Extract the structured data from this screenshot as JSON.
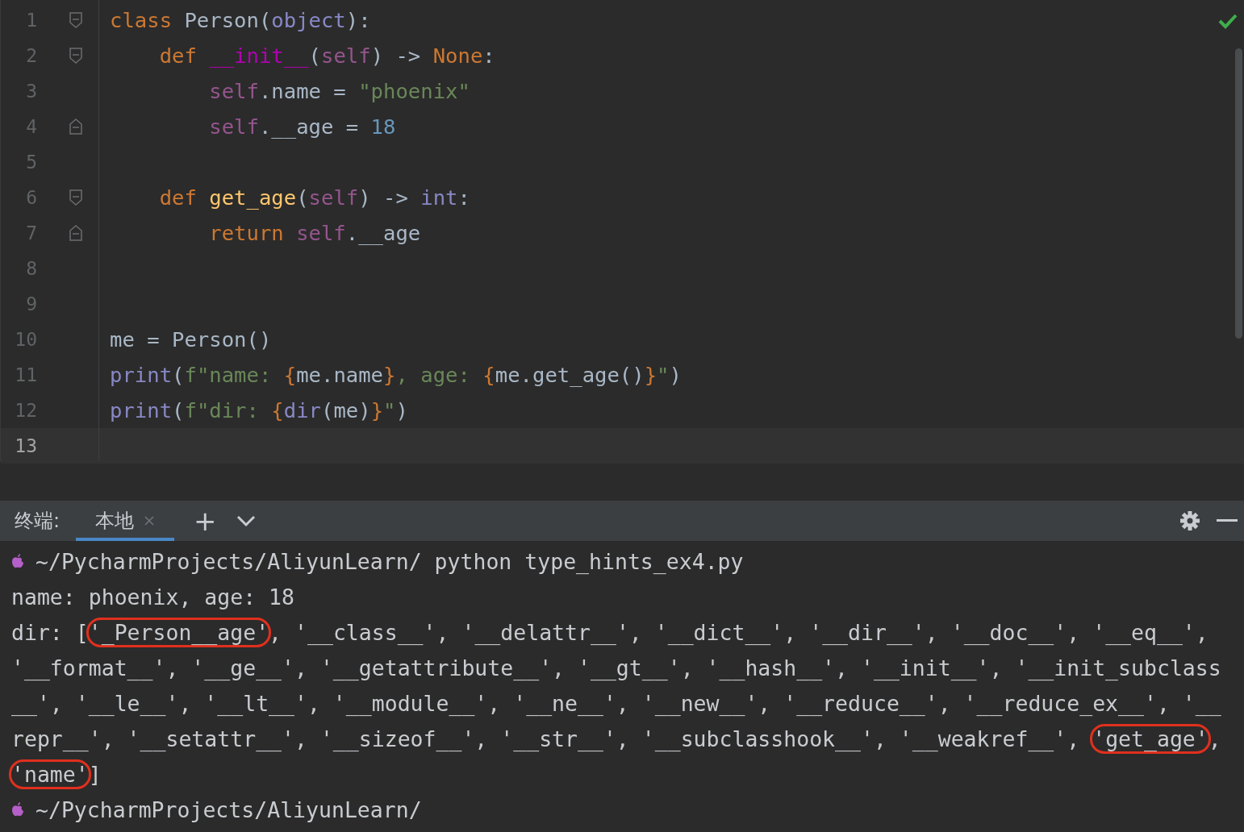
{
  "editor": {
    "checked": true,
    "lines": [
      {
        "number": "1",
        "fold_start": true,
        "fold_end": false,
        "current": false,
        "tokens": [
          {
            "text": "class ",
            "kind": "keyword"
          },
          {
            "text": "Person(",
            "kind": "plain"
          },
          {
            "text": "object",
            "kind": "builtin"
          },
          {
            "text": "):",
            "kind": "plain"
          }
        ]
      },
      {
        "number": "2",
        "fold_start": true,
        "fold_end": false,
        "current": false,
        "tokens": [
          {
            "text": "    def ",
            "kind": "keyword"
          },
          {
            "text": "__init__",
            "kind": "magic"
          },
          {
            "text": "(",
            "kind": "plain"
          },
          {
            "text": "self",
            "kind": "self"
          },
          {
            "text": ") -> ",
            "kind": "plain"
          },
          {
            "text": "None",
            "kind": "keyword"
          },
          {
            "text": ":",
            "kind": "plain"
          }
        ]
      },
      {
        "number": "3",
        "fold_start": false,
        "fold_end": false,
        "current": false,
        "tokens": [
          {
            "text": "        self",
            "kind": "self"
          },
          {
            "text": ".name = ",
            "kind": "plain"
          },
          {
            "text": "\"phoenix\"",
            "kind": "string"
          }
        ]
      },
      {
        "number": "4",
        "fold_start": false,
        "fold_end": true,
        "current": false,
        "tokens": [
          {
            "text": "        self",
            "kind": "self"
          },
          {
            "text": ".__age = ",
            "kind": "plain"
          },
          {
            "text": "18",
            "kind": "number"
          }
        ]
      },
      {
        "number": "5",
        "fold_start": false,
        "fold_end": false,
        "current": false
      },
      {
        "number": "6",
        "fold_start": true,
        "fold_end": false,
        "current": false,
        "tokens": [
          {
            "text": "    def ",
            "kind": "keyword"
          },
          {
            "text": "get_age",
            "kind": "function"
          },
          {
            "text": "(",
            "kind": "plain"
          },
          {
            "text": "self",
            "kind": "self"
          },
          {
            "text": ") -> ",
            "kind": "plain"
          },
          {
            "text": "int",
            "kind": "builtin"
          },
          {
            "text": ":",
            "kind": "plain"
          }
        ]
      },
      {
        "number": "7",
        "fold_start": false,
        "fold_end": true,
        "current": false,
        "tokens": [
          {
            "text": "        return ",
            "kind": "keyword"
          },
          {
            "text": "self",
            "kind": "self"
          },
          {
            "text": ".__age",
            "kind": "plain"
          }
        ]
      },
      {
        "number": "8",
        "fold_start": false,
        "fold_end": false,
        "current": false
      },
      {
        "number": "9",
        "fold_start": false,
        "fold_end": false,
        "current": false
      },
      {
        "number": "10",
        "fold_start": false,
        "fold_end": false,
        "current": false,
        "tokens": [
          {
            "text": "me = Person()",
            "kind": "plain"
          }
        ]
      },
      {
        "number": "11",
        "fold_start": false,
        "fold_end": false,
        "current": false,
        "tokens": [
          {
            "text": "print",
            "kind": "builtin"
          },
          {
            "text": "(",
            "kind": "plain"
          },
          {
            "text": "f\"name: ",
            "kind": "string"
          },
          {
            "text": "{",
            "kind": "keyword"
          },
          {
            "text": "me.name",
            "kind": "plain"
          },
          {
            "text": "}",
            "kind": "keyword"
          },
          {
            "text": ", age: ",
            "kind": "string"
          },
          {
            "text": "{",
            "kind": "keyword"
          },
          {
            "text": "me.get_age()",
            "kind": "plain"
          },
          {
            "text": "}",
            "kind": "keyword"
          },
          {
            "text": "\"",
            "kind": "string"
          },
          {
            "text": ")",
            "kind": "plain"
          }
        ]
      },
      {
        "number": "12",
        "fold_start": false,
        "fold_end": false,
        "current": false,
        "tokens": [
          {
            "text": "print",
            "kind": "builtin"
          },
          {
            "text": "(",
            "kind": "plain"
          },
          {
            "text": "f\"dir: ",
            "kind": "string"
          },
          {
            "text": "{",
            "kind": "keyword"
          },
          {
            "text": "dir",
            "kind": "builtin"
          },
          {
            "text": "(me)",
            "kind": "plain"
          },
          {
            "text": "}",
            "kind": "keyword"
          },
          {
            "text": "\"",
            "kind": "string"
          },
          {
            "text": ")",
            "kind": "plain"
          }
        ]
      },
      {
        "number": "13",
        "fold_start": false,
        "fold_end": false,
        "current": true
      }
    ]
  },
  "terminal": {
    "title": "终端:",
    "tabs": [
      {
        "label": "本地",
        "selected": true
      }
    ],
    "add": "+",
    "lines": [
      {
        "kind": "prompt",
        "path": "~/PycharmProjects/AliyunLearn/",
        "command": "python type_hints_ex4.py"
      },
      {
        "kind": "output",
        "segments": [
          {
            "text": "name: phoenix, age: 18",
            "circled": false
          }
        ]
      },
      {
        "kind": "output",
        "segments": [
          {
            "text": "dir: [",
            "circled": false
          },
          {
            "text": "'_Person__age'",
            "circled": true
          },
          {
            "text": ", '__class__', '__delattr__', '__dict__', '__dir__', '__doc__', '__eq__',",
            "circled": false
          }
        ]
      },
      {
        "kind": "output",
        "segments": [
          {
            "text": "'__format__', '__ge__', '__getattribute__', '__gt__', '__hash__', '__init__', '__init_subclass",
            "circled": false
          }
        ]
      },
      {
        "kind": "output",
        "segments": [
          {
            "text": "__', '__le__', '__lt__', '__module__', '__ne__', '__new__', '__reduce__', '__reduce_ex__', '__",
            "circled": false
          }
        ]
      },
      {
        "kind": "output",
        "segments": [
          {
            "text": "repr__', '__setattr__', '__sizeof__', '__str__', '__subclasshook__', '__weakref__', ",
            "circled": false
          },
          {
            "text": "'get_age'",
            "circled": true
          },
          {
            "text": ",",
            "circled": false
          }
        ]
      },
      {
        "kind": "output",
        "segments": [
          {
            "text": "'name'",
            "circled": true
          },
          {
            "text": "]",
            "circled": false
          }
        ]
      },
      {
        "kind": "prompt",
        "path": "~/PycharmProjects/AliyunLearn/"
      }
    ]
  }
}
